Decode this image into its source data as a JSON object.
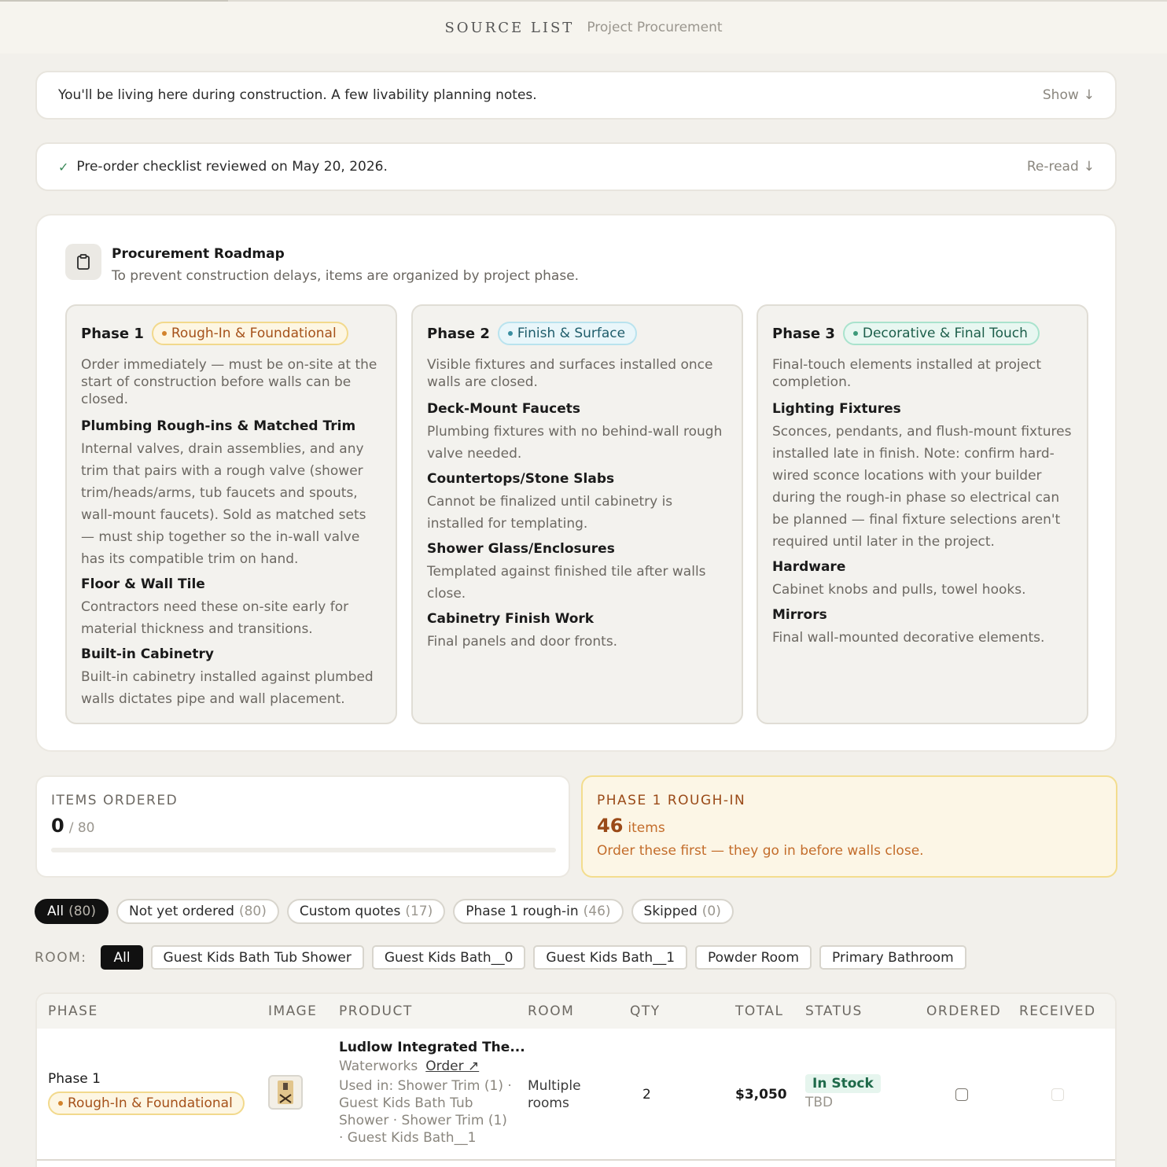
{
  "header": {
    "brand": "SOURCE LIST",
    "subtitle": "Project Procurement"
  },
  "banners": {
    "living": {
      "text": "You'll be living here during construction. A few livability planning notes.",
      "action": "Show"
    },
    "checklist": {
      "text": "Pre-order checklist reviewed on May 20, 2026.",
      "action": "Re-read"
    }
  },
  "roadmap": {
    "title": "Procurement Roadmap",
    "subtitle": "To prevent construction delays, items are organized by project phase.",
    "phases": [
      {
        "name": "Phase 1",
        "tag": "Rough-In & Foundational",
        "desc": "Order immediately — must be on-site at the start of construction before walls can be closed.",
        "items": [
          {
            "title": "Plumbing Rough-ins & Matched Trim",
            "desc": "Internal valves, drain assemblies, and any trim that pairs with a rough valve (shower trim/heads/arms, tub faucets and spouts, wall-mount faucets). Sold as matched sets — must ship together so the in-wall valve has its compatible trim on hand."
          },
          {
            "title": "Floor & Wall Tile",
            "desc": "Contractors need these on-site early for material thickness and transitions."
          },
          {
            "title": "Built-in Cabinetry",
            "desc": "Built-in cabinetry installed against plumbed walls dictates pipe and wall placement."
          }
        ]
      },
      {
        "name": "Phase 2",
        "tag": "Finish & Surface",
        "desc": "Visible fixtures and surfaces installed once walls are closed.",
        "items": [
          {
            "title": "Deck-Mount Faucets",
            "desc": "Plumbing fixtures with no behind-wall rough valve needed."
          },
          {
            "title": "Countertops/Stone Slabs",
            "desc": "Cannot be finalized until cabinetry is installed for templating."
          },
          {
            "title": "Shower Glass/Enclosures",
            "desc": "Templated against finished tile after walls close."
          },
          {
            "title": "Cabinetry Finish Work",
            "desc": "Final panels and door fronts."
          }
        ]
      },
      {
        "name": "Phase 3",
        "tag": "Decorative & Final Touch",
        "desc": "Final-touch elements installed at project completion.",
        "items": [
          {
            "title": "Lighting Fixtures",
            "desc": "Sconces, pendants, and flush-mount fixtures installed late in finish. Note: confirm hard-wired sconce locations with your builder during the rough-in phase so electrical can be planned — final fixture selections aren't required until later in the project."
          },
          {
            "title": "Hardware",
            "desc": "Cabinet knobs and pulls, towel hooks."
          },
          {
            "title": "Mirrors",
            "desc": "Final wall-mounted decorative elements."
          }
        ]
      }
    ]
  },
  "stats": {
    "ordered": {
      "label": "ITEMS ORDERED",
      "value": "0",
      "total": "/ 80",
      "progress": 0
    },
    "phase1": {
      "label": "PHASE 1 ROUGH-IN",
      "value": "46",
      "unit": "items",
      "note": "Order these first — they go in before walls close."
    }
  },
  "filters": [
    {
      "label": "All",
      "count": "(80)",
      "active": true
    },
    {
      "label": "Not yet ordered",
      "count": "(80)"
    },
    {
      "label": "Custom quotes",
      "count": "(17)"
    },
    {
      "label": "Phase 1 rough-in",
      "count": "(46)"
    },
    {
      "label": "Skipped",
      "count": "(0)"
    }
  ],
  "rooms": {
    "label": "ROOM:",
    "options": [
      "All",
      "Guest Kids Bath Tub Shower",
      "Guest Kids Bath__0",
      "Guest Kids Bath__1",
      "Powder Room",
      "Primary Bathroom"
    ]
  },
  "table": {
    "columns": [
      "PHASE",
      "IMAGE",
      "PRODUCT",
      "ROOM",
      "QTY",
      "TOTAL",
      "STATUS",
      "ORDERED",
      "RECEIVED"
    ],
    "rows": [
      {
        "phase": "Phase 1",
        "phase_tag": "Rough-In & Foundational",
        "product": "Ludlow Integrated The...",
        "vendor": "Waterworks",
        "order_link": "Order ↗",
        "used_in": "Used in: Shower Trim (1) · Guest Kids Bath Tub Shower · Shower Trim (1) · Guest Kids Bath__1",
        "room": "Multiple rooms",
        "qty": "2",
        "total": "$3,050",
        "status": "In Stock",
        "status_sub": "TBD"
      }
    ]
  },
  "colors": {
    "accent_amber": "#c36c2a",
    "status_green": "#1f6a4a",
    "active_chip": "#111111"
  }
}
